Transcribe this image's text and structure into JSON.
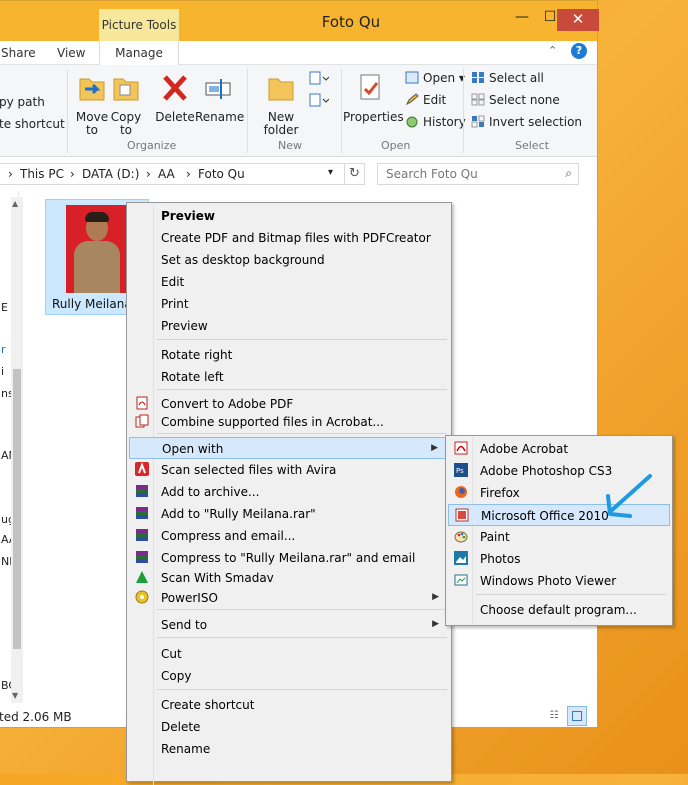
{
  "window": {
    "title": "Foto Qu",
    "context_tab_head": "Picture Tools",
    "close_glyph": "✕",
    "min_glyph": "—",
    "max_glyph": "☐"
  },
  "ribbon": {
    "tabs": [
      "Share",
      "View",
      "Manage"
    ],
    "help_glyph": "?",
    "minimize_glyph": "⌃",
    "clipboard_partial": [
      "py path",
      "te shortcut"
    ],
    "organize": {
      "label": "Organize",
      "move_to": "Move to",
      "copy_to": "Copy to",
      "delete": "Delete",
      "rename": "Rename"
    },
    "new": {
      "label": "New",
      "new_folder": "New folder"
    },
    "open": {
      "label": "Open",
      "properties": "Properties",
      "open_btn": "Open",
      "edit": "Edit",
      "history": "History"
    },
    "select": {
      "label": "Select",
      "select_all": "Select all",
      "select_none": "Select none",
      "invert": "Invert selection"
    }
  },
  "address": {
    "crumbs": [
      "This PC",
      "DATA (D:)",
      "AA",
      "Foto Qu"
    ],
    "sep": "›",
    "search_placeholder": "Search Foto Qu"
  },
  "navpane": {
    "fragments": [
      "E",
      "r",
      "i",
      "ns",
      "AN",
      "ug",
      "AA",
      "NK",
      "BC"
    ]
  },
  "file": {
    "name": "Rully Meilana"
  },
  "status": {
    "text": "ted  2.06 MB"
  },
  "context_menu": {
    "items": [
      {
        "label": "Preview",
        "bold": true
      },
      {
        "label": "Create PDF and Bitmap files with PDFCreator"
      },
      {
        "label": "Set as desktop background"
      },
      {
        "label": "Edit"
      },
      {
        "label": "Print"
      },
      {
        "label": "Preview"
      },
      {
        "label": "Rotate right"
      },
      {
        "label": "Rotate left"
      },
      {
        "label": "Convert to Adobe PDF",
        "icon": "adobe-pdf-icon"
      },
      {
        "label": "Combine supported files in Acrobat...",
        "icon": "acrobat-combine-icon"
      },
      {
        "label": "Open with",
        "submenu": true
      },
      {
        "label": "Scan selected files with Avira",
        "icon": "avira-icon"
      },
      {
        "label": "Add to archive...",
        "icon": "winrar-icon"
      },
      {
        "label": "Add to \"Rully Meilana.rar\"",
        "icon": "winrar-icon"
      },
      {
        "label": "Compress and email...",
        "icon": "winrar-icon"
      },
      {
        "label": "Compress to \"Rully Meilana.rar\" and email",
        "icon": "winrar-icon"
      },
      {
        "label": "Scan With Smadav",
        "icon": "smadav-icon"
      },
      {
        "label": "PowerISO",
        "icon": "poweriso-icon",
        "submenu": true
      },
      {
        "label": "Send to",
        "submenu": true
      },
      {
        "label": "Cut"
      },
      {
        "label": "Copy"
      },
      {
        "label": "Create shortcut"
      },
      {
        "label": "Delete"
      },
      {
        "label": "Rename"
      }
    ]
  },
  "open_with_menu": {
    "items": [
      {
        "label": "Adobe Acrobat",
        "icon": "adobe-acrobat-icon"
      },
      {
        "label": "Adobe Photoshop CS3",
        "icon": "photoshop-icon"
      },
      {
        "label": "Firefox",
        "icon": "firefox-icon"
      },
      {
        "label": "Microsoft Office 2010",
        "icon": "ms-office-picture-icon",
        "highlighted": true
      },
      {
        "label": "Paint",
        "icon": "paint-icon"
      },
      {
        "label": "Photos",
        "icon": "photos-icon"
      },
      {
        "label": "Windows Photo Viewer",
        "icon": "photo-viewer-icon"
      },
      {
        "label": "Choose default program..."
      }
    ]
  },
  "colors": {
    "titlebar": "#f7b52f",
    "highlight": "#d6e8fb",
    "annotation_arrow": "#1e9be0"
  }
}
